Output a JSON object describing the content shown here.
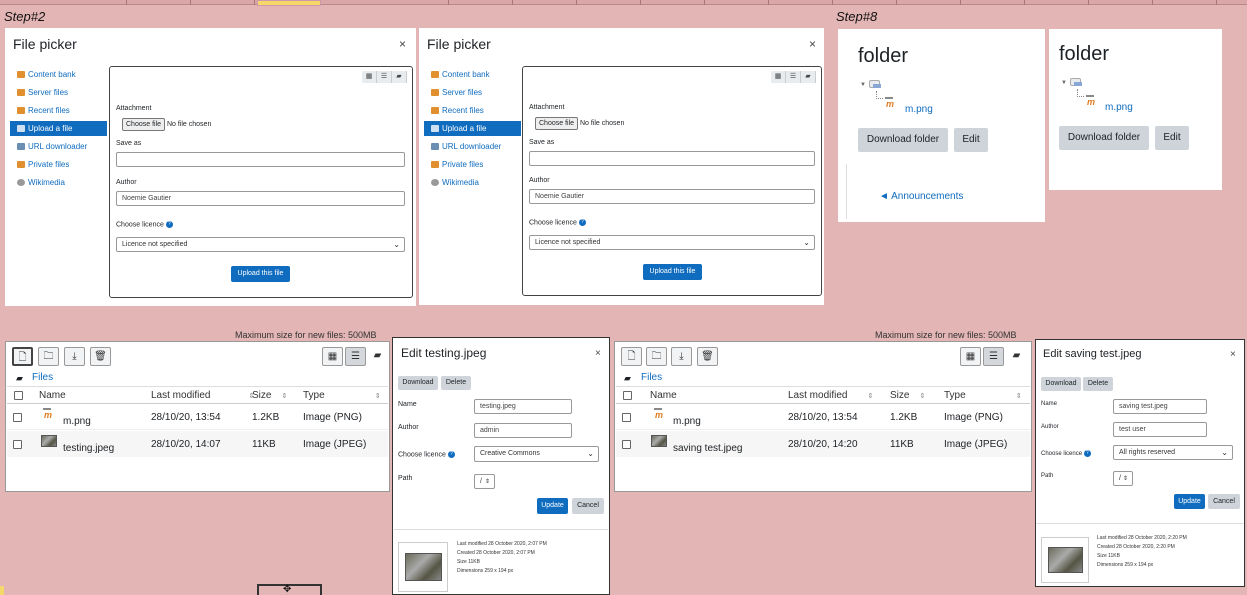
{
  "steps": {
    "step2": "Step#2",
    "step8": "Step#8"
  },
  "filepicker": {
    "title": "File picker",
    "close": "×",
    "nav": [
      "Content bank",
      "Server files",
      "Recent files",
      "Upload a file",
      "URL downloader",
      "Private files",
      "Wikimedia"
    ],
    "active_index": 3,
    "attachment_label": "Attachment",
    "choose_file": "Choose file",
    "no_file": "No file chosen",
    "save_as_label": "Save as",
    "author_label": "Author",
    "author_value": "Noemie Gautier",
    "licence_label": "Choose licence",
    "licence_value": "Licence not specified",
    "upload_btn": "Upload this file"
  },
  "folder": {
    "title": "folder",
    "file": "m.png",
    "download_btn": "Download folder",
    "edit_btn": "Edit",
    "back_link": "◄ Announcements"
  },
  "filemanager": {
    "max_size_left": "Maximum size for new files: 500MB",
    "max_size_right": "Maximum size for new files: 500MB",
    "breadcrumb": "Files",
    "columns": [
      "Name",
      "Last modified",
      "Size",
      "Type"
    ],
    "left_rows": [
      {
        "name": "m.png",
        "modified": "28/10/20, 13:54",
        "size": "1.2KB",
        "type": "Image (PNG)"
      },
      {
        "name": "testing.jpeg",
        "modified": "28/10/20, 14:07",
        "size": "11KB",
        "type": "Image (JPEG)"
      }
    ],
    "right_rows": [
      {
        "name": "m.png",
        "modified": "28/10/20, 13:54",
        "size": "1.2KB",
        "type": "Image (PNG)"
      },
      {
        "name": "saving test.jpeg",
        "modified": "28/10/20, 14:20",
        "size": "11KB",
        "type": "Image (JPEG)"
      }
    ]
  },
  "edit1": {
    "title": "Edit testing.jpeg",
    "download": "Download",
    "delete": "Delete",
    "name_label": "Name",
    "name_value": "testing.jpeg",
    "author_label": "Author",
    "author_value": "admin",
    "licence_label": "Choose licence",
    "licence_value": "Creative Commons",
    "path_label": "Path",
    "path_value": "/",
    "update": "Update",
    "cancel": "Cancel",
    "info": [
      "Last modified  28 October 2020, 2:07 PM",
      "Created  28 October 2020, 2:07 PM",
      "Size  11KB",
      "Dimensions  259 x 194 px"
    ]
  },
  "edit2": {
    "title": "Edit saving test.jpeg",
    "download": "Download",
    "delete": "Delete",
    "name_label": "Name",
    "name_value": "saving test.jpeg",
    "author_label": "Author",
    "author_value": "test user",
    "licence_label": "Choose licence",
    "licence_value": "All rights reserved",
    "path_label": "Path",
    "path_value": "/",
    "update": "Update",
    "cancel": "Cancel",
    "info": [
      "Last modified  28 October 2020, 2:20 PM",
      "Created  28 October 2020, 2:20 PM",
      "Size  11KB",
      "Dimensions  259 x 194 px"
    ]
  },
  "colors": {
    "accent": "#0f6cbf",
    "background": "#e3b5b5"
  }
}
